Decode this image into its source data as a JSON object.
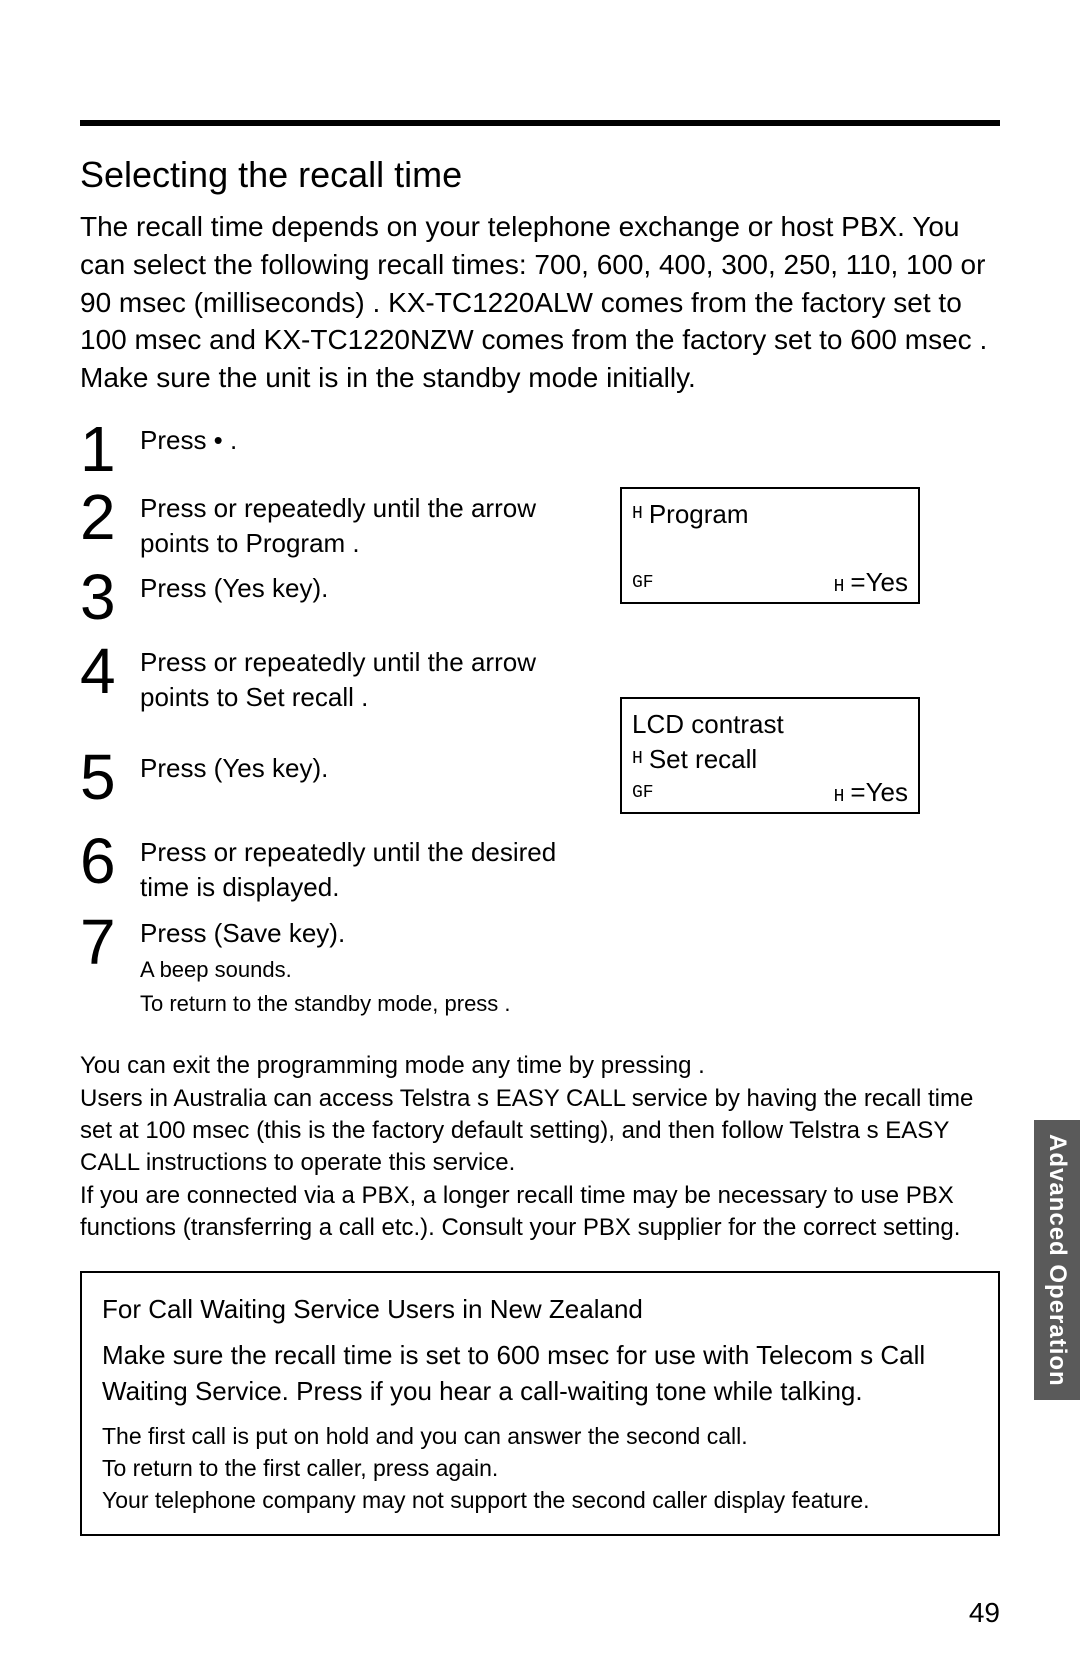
{
  "title": "Selecting the recall time",
  "intro": "The recall time depends on your telephone exchange or host PBX. You can select the following recall times:  700, 600, 400, 300, 250, 110, 100 or 90 msec (milliseconds) . KX-TC1220ALW comes from the factory set to  100 msec  and KX-TC1220NZW comes from the factory set to  600 msec . Make sure the unit is in the standby mode initially.",
  "steps": [
    {
      "num": "1",
      "text": "Press   •                         ."
    },
    {
      "num": "2",
      "text": "Press       or       repeatedly until the arrow points to  Program   ."
    },
    {
      "num": "3",
      "text": "Press        (Yes  key)."
    },
    {
      "num": "4",
      "text": "Press       or       repeatedly until the arrow points to  Set recall         ."
    },
    {
      "num": "5",
      "text": "Press        (Yes  key)."
    },
    {
      "num": "6",
      "text": "Press       or       repeatedly until the desired time is displayed."
    },
    {
      "num": "7",
      "text": "Press        (Save  key).",
      "sub1": " A beep sounds.",
      "sub2": " To return to the standby mode, press                ."
    }
  ],
  "lcd1": {
    "line1": "Program",
    "bottom_left": "GF",
    "bottom_right": "=Yes"
  },
  "lcd2": {
    "line1": " LCD contrast",
    "line2": "Set  recall",
    "bottom_left": "GF",
    "bottom_right": "=Yes"
  },
  "notes": "You can exit the programming mode any time by pressing                 .\nUsers in Australia can access Telstra s  EASY CALL  service by having the recall time set at 100 msec (this is the factory default setting), and then follow Telstra s  EASY CALL  instructions to operate this service.\nIf you are connected via a PBX, a longer recall time may be necessary to use PBX functions (transferring a call etc.). Consult your PBX supplier for the correct setting.",
  "box": {
    "heading": "For Call Waiting Service Users in New Zealand",
    "body": "Make sure the recall time is set to 600 msec for use with Telecom s Call Waiting Service. Press                  if you hear a call-waiting tone while talking.",
    "sub": "The ﬁrst call is put on hold and you can answer the second call.\nTo return to the ﬁrst caller, press                   again.\nYour telephone company may not support the second caller display feature."
  },
  "sidetab": "Advanced Operation",
  "pagenum": "49"
}
